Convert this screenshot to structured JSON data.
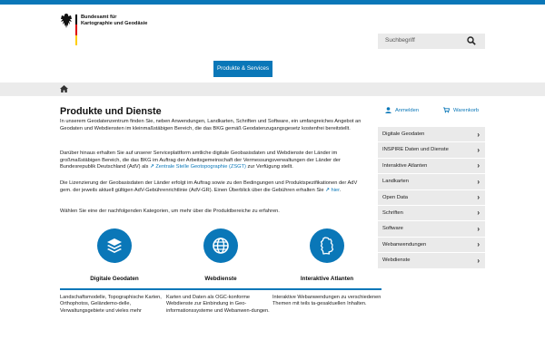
{
  "logo": {
    "name_line1": "Bundesamt für",
    "name_line2": "Kartographie und Geodäsie",
    "flag_colors": [
      "#000000",
      "#dd0000",
      "#ffce00"
    ]
  },
  "search": {
    "placeholder": "Suchbegriff",
    "icon": "search-icon"
  },
  "nav": {
    "products_label": "Produkte & Services"
  },
  "breadcrumb": {
    "icon": "home-icon"
  },
  "account": {
    "login_label": "Anmelden",
    "cart_label": "Warenkorb"
  },
  "main": {
    "title": "Produkte und Dienste",
    "p1": "In unserem Geodatenzentrum finden Sie, neben Anwendungen, Landkarten, Schriften und Software, ein umfangreiches Angebot an Geodaten und Webdiensten im kleinmaßstäbigen Bereich, die das BKG gemäß Geodatenzugangsgesetz kostenfrei bereitstellt.",
    "p2_before": "Darüber hinaus erhalten Sie auf unserer Serviceplattform amtliche digitale Geobasisdaten und Webdienste der Länder im großmaßstäbigen Bereich, die das BKG im Auftrag der Arbeitsgemeinschaft der Vermessungsverwaltungen der Länder der Bundesrepublik Deutschland (AdV) als ",
    "p2_link": "Zentrale Stelle Geotopographie (ZSGT)",
    "p2_after": " zur Verfügung stellt.",
    "p3_before": "Die Lizenzierung der Geobasisdaten der Länder erfolgt im Auftrag sowie zu den Bedingungen und Produktspezifikationen der AdV gem. der jeweils aktuell gültigen AdV-Gebührenrichtlinie (AdV-GR). Einen Überblick über die Gebühren erhalten Sie ",
    "p3_link": "hier",
    "p3_after": ".",
    "p4": "Wählen Sie eine der nachfolgenden Kategorien, um mehr über die Produktbereiche zu erfahren."
  },
  "categories": [
    {
      "title": "Digitale Geodaten",
      "icon": "layers-icon",
      "desc": "Landschaftsmodelle, Topographische Karten, Orthophotos, Geländemo-delle, Verwaltungsgebiete und vieles mehr"
    },
    {
      "title": "Webdienste",
      "icon": "globe-icon",
      "desc": "Karten und Daten als OGC-konforme Webdienste zur Einbindung in Geo-informationssysteme und Webanwen-dungen."
    },
    {
      "title": "Interaktive Atlanten",
      "icon": "germany-map-icon",
      "desc": "Interaktive Webanwendungen zu verschiedenen Themen mit teils ta-gesaktuellen Inhalten."
    }
  ],
  "sidebar": {
    "items": [
      {
        "label": "Digitale Geodaten"
      },
      {
        "label": "INSPIRE Daten und Dienste"
      },
      {
        "label": "Interaktive Atlanten"
      },
      {
        "label": "Landkarten"
      },
      {
        "label": "Open Data"
      },
      {
        "label": "Schriften"
      },
      {
        "label": "Software"
      },
      {
        "label": "Webanwendungen"
      },
      {
        "label": "Webdienste"
      }
    ],
    "chevron": "›"
  },
  "colors": {
    "brand": "#0a77b8",
    "panel": "#eaeaea"
  }
}
